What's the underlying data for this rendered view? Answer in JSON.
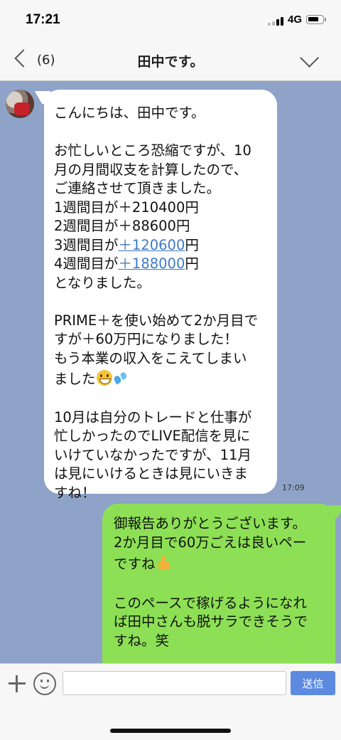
{
  "status": {
    "time": "17:21",
    "network": "4G"
  },
  "header": {
    "back_count": "(6)",
    "title": "田中です。"
  },
  "incoming": {
    "lines": [
      "こんにちは、田中です。",
      "",
      "お忙しいところ恐縮ですが、10",
      "月の月間収支を計算したので、",
      "ご連絡させて頂きました。",
      "1週間目が＋210400円",
      "2週間目が＋88600円"
    ],
    "week3_prefix": "3週間目が",
    "week3_amount": "＋120600",
    "week3_suffix": "円",
    "week4_prefix": "4週間目が",
    "week4_amount": "＋188000",
    "week4_suffix": "円",
    "lines2": [
      "となりました。",
      "",
      "PRIME＋を使い始めて2か月目で",
      "すが＋60万円になりました！",
      "もう本業の収入をこえてしまい"
    ],
    "line_emoji": "ました",
    "lines3": [
      "",
      "10月は自分のトレードと仕事が",
      "忙しかったのでLIVE配信を見に",
      "いけていなかったですが、11月",
      "は見にいけるときは見にいきま",
      "すね！"
    ],
    "timestamp": "17:09"
  },
  "outgoing": {
    "lines": [
      "御報告ありがとうございます。",
      "2か月目で60万ごえは良いペー"
    ],
    "line_emoji": "ですね",
    "lines2": [
      "",
      "このペースで稼げるようになれ",
      "ば田中さんも脱サラできそうで",
      "すね。笑"
    ]
  },
  "input": {
    "placeholder": "",
    "send_label": "送信"
  },
  "icons": [
    "back-icon",
    "chevron-down-icon",
    "plus-icon",
    "emoji-icon",
    "grinning-face-icon",
    "sweat-droplets-icon",
    "thumbs-up-icon"
  ]
}
